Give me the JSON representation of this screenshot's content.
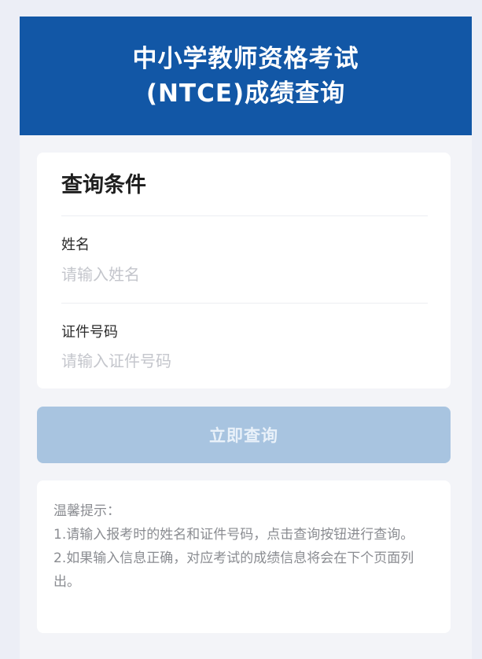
{
  "header": {
    "title_line1": "中小学教师资格考试",
    "title_line2": "(NTCE)成绩查询"
  },
  "form": {
    "section_title": "查询条件",
    "name": {
      "label": "姓名",
      "placeholder": "请输入姓名",
      "value": ""
    },
    "id_number": {
      "label": "证件号码",
      "placeholder": "请输入证件号码",
      "value": ""
    },
    "submit_label": "立即查询"
  },
  "tips": {
    "heading": "温馨提示：",
    "line1": "1.请输入报考时的姓名和证件号码，点击查询按钮进行查询。",
    "line2": "2.如果输入信息正确，对应考试的成绩信息将会在下个页面列出。"
  },
  "colors": {
    "header_bg": "#1257a6",
    "button_disabled": "#a8c4e0",
    "page_bg": "#f3f4f8"
  }
}
